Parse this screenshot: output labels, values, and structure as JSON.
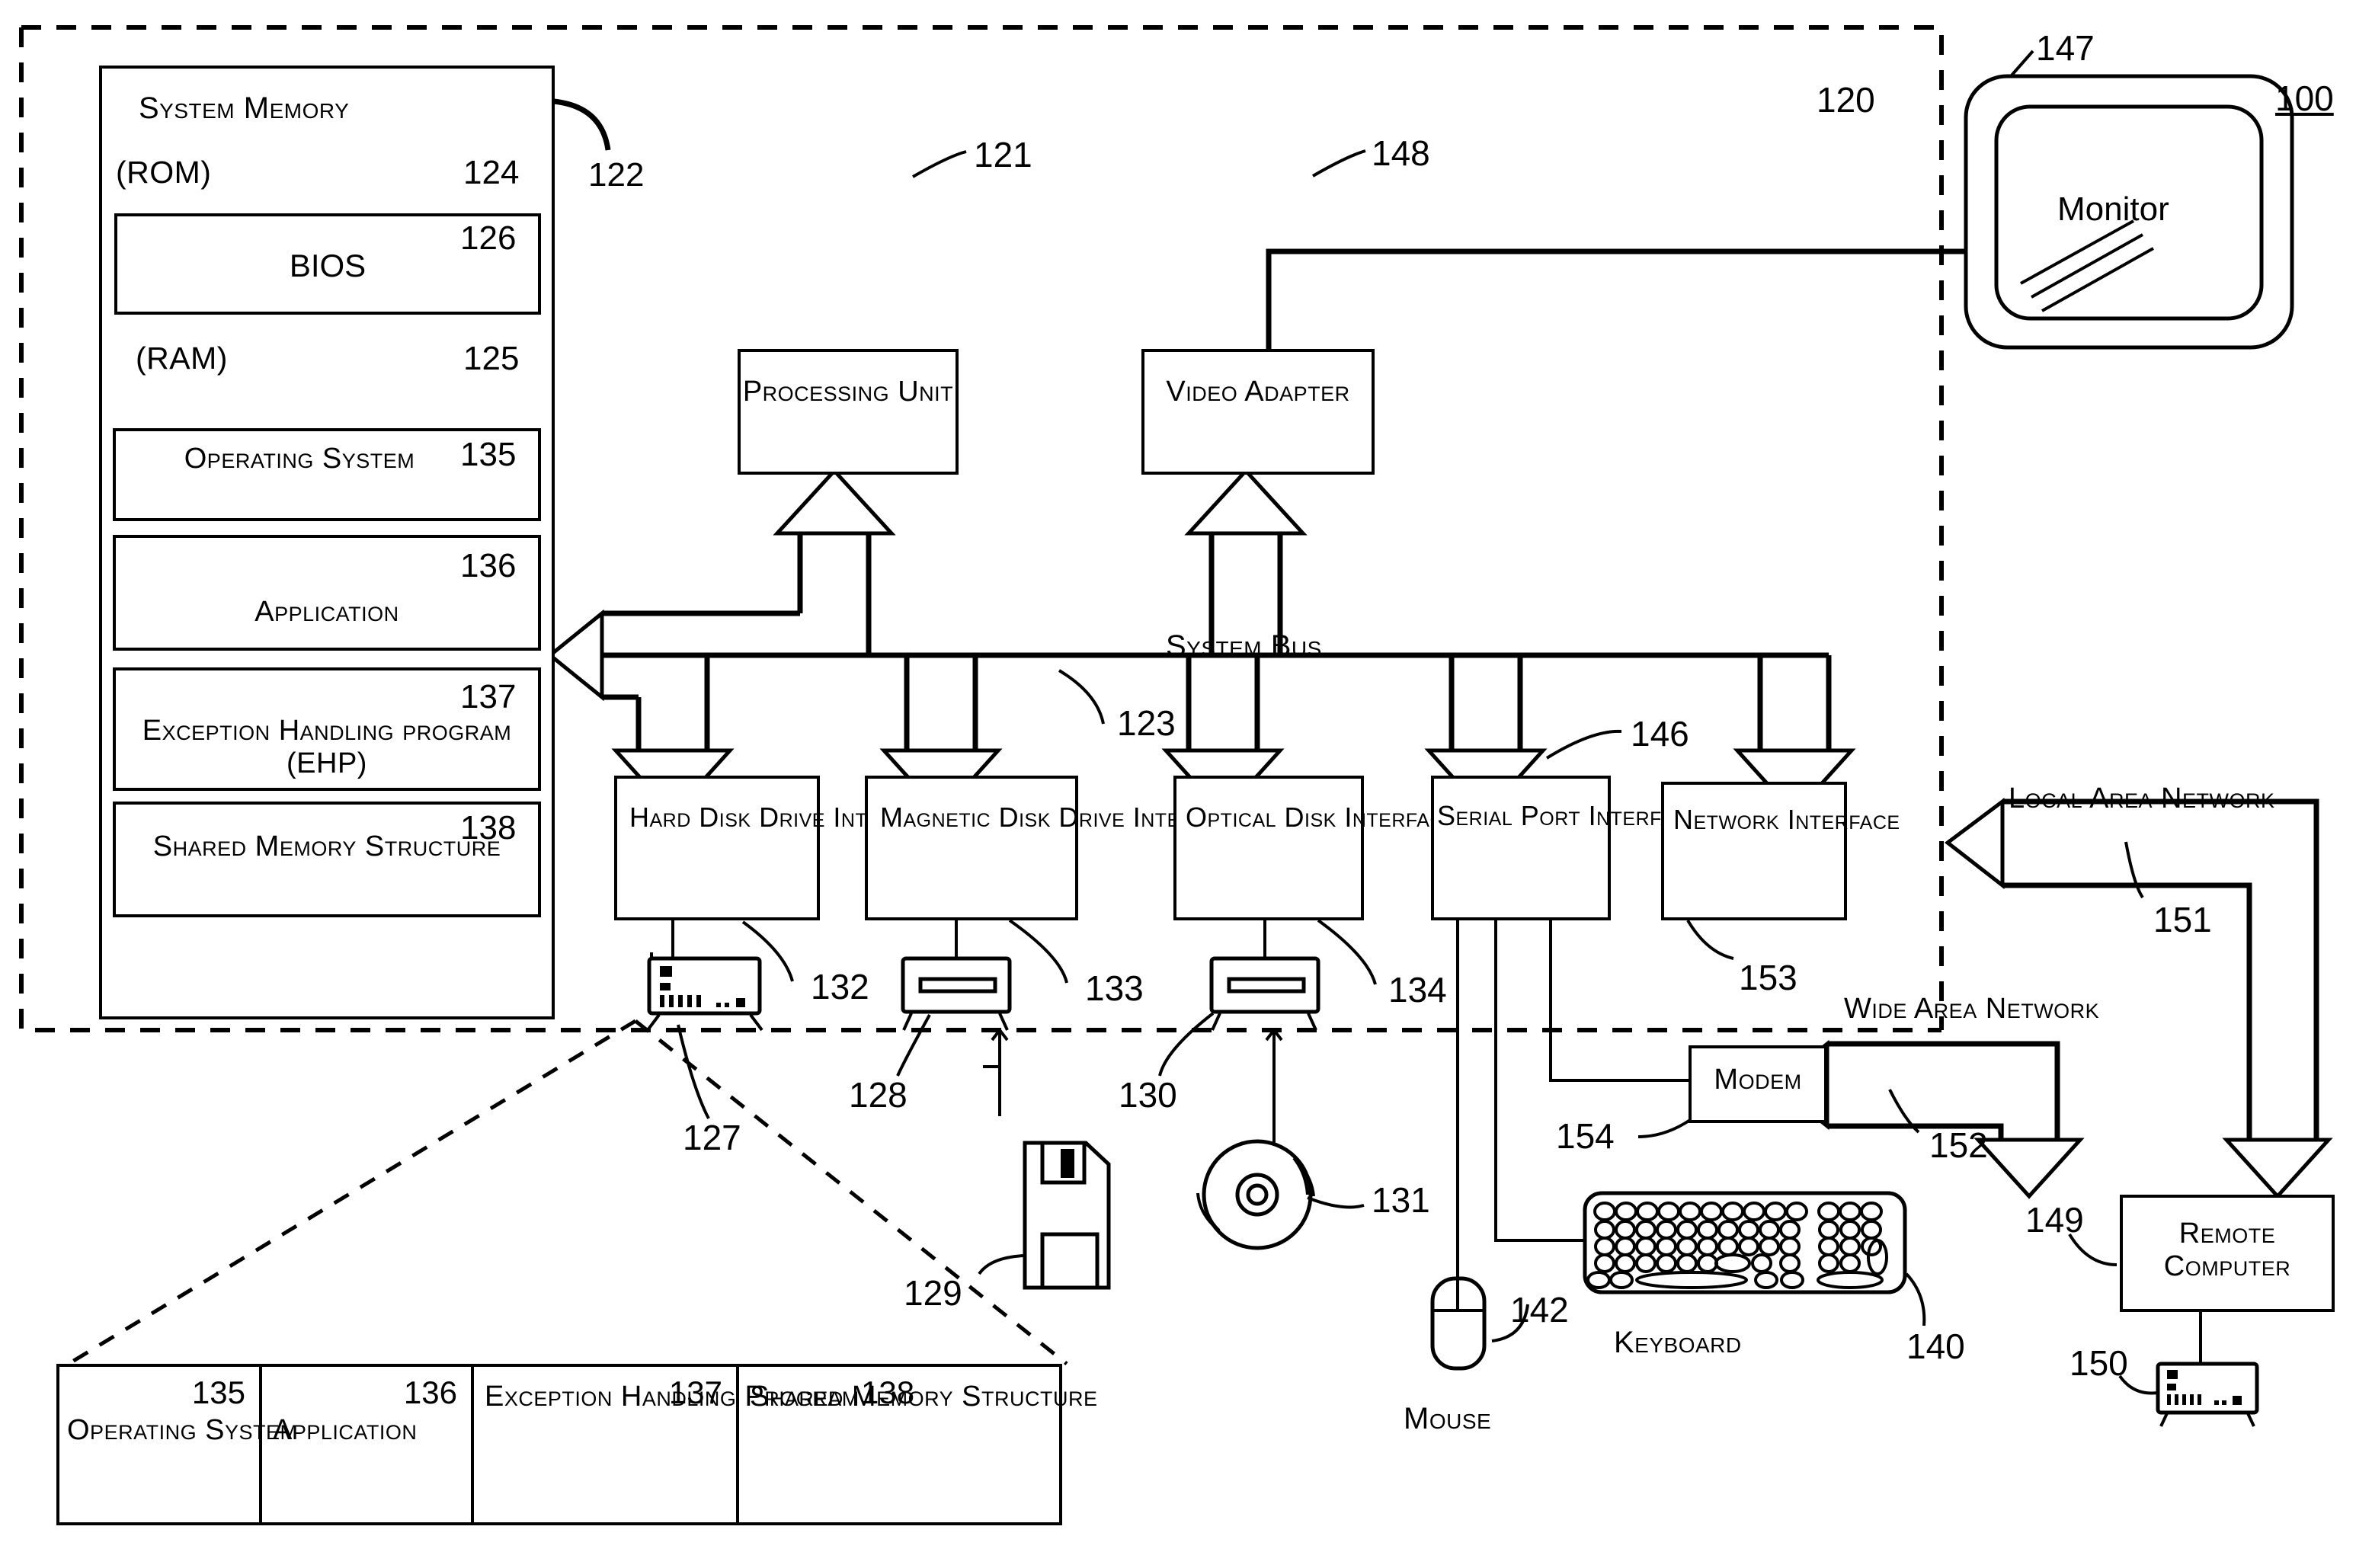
{
  "figure": {
    "id_label": "100",
    "computer_boundary_label": "120",
    "system_memory": {
      "title": "System Memory",
      "callout": "122",
      "rom": {
        "label": "(ROM)",
        "callout": "124",
        "bios": {
          "label": "BIOS",
          "callout": "126"
        }
      },
      "ram": {
        "label": "(RAM)",
        "callout": "125",
        "modules": [
          {
            "label": "Operating System",
            "callout": "135"
          },
          {
            "label": "Application",
            "callout": "136"
          },
          {
            "label": "Exception Handling program (EHP)",
            "callout": "137"
          },
          {
            "label": "Shared Memory Structure",
            "callout": "138"
          }
        ]
      }
    },
    "processing_unit": {
      "label": "Processing Unit",
      "callout": "121"
    },
    "video_adapter": {
      "label": "Video Adapter",
      "callout": "148"
    },
    "monitor": {
      "label": "Monitor",
      "callout": "147"
    },
    "system_bus": {
      "label": "System Bus",
      "callout": "123"
    },
    "interfaces": [
      {
        "label": "Hard Disk Drive Interface",
        "callout": "132",
        "device_callout": "127",
        "device": "hard-disk-drive"
      },
      {
        "label": "Magnetic Disk Drive Interface",
        "callout": "133",
        "device_callout": "128",
        "media_callout": "129",
        "device": "magnetic-disk-drive"
      },
      {
        "label": "Optical Disk Interface",
        "callout": "134",
        "device_callout": "130",
        "media_callout": "131",
        "device": "optical-disk-drive"
      },
      {
        "label": "Serial Port Interface",
        "callout": "146",
        "device": "serial-port"
      },
      {
        "label": "Network Interface",
        "callout": "153",
        "device": "network"
      }
    ],
    "modem": {
      "label": "Modem",
      "callout": "154"
    },
    "keyboard": {
      "label": "Keyboard",
      "callout": "140"
    },
    "mouse": {
      "label": "Mouse",
      "callout": "142"
    },
    "local_area_network": {
      "label": "Local Area Network",
      "callout": "151"
    },
    "wide_area_network": {
      "label": "Wide Area Network",
      "callout": "152"
    },
    "remote_computer": {
      "label": "Remote Computer",
      "callout": "149",
      "device_callout": "150"
    },
    "detail_strip": {
      "cells": [
        {
          "callout": "135",
          "label": "Operating System"
        },
        {
          "callout": "136",
          "label": "Application"
        },
        {
          "callout": "137",
          "label": "Exception Handling Program"
        },
        {
          "callout": "138",
          "label": "Shared Memory Structure"
        }
      ]
    }
  }
}
